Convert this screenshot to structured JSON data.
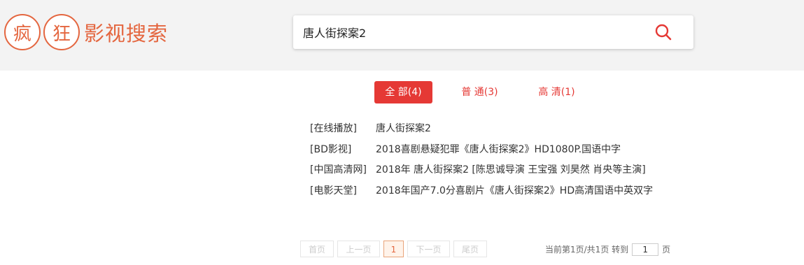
{
  "logo": {
    "char1": "疯",
    "char2": "狂",
    "text": "影视搜索"
  },
  "search": {
    "value": "唐人街探案2",
    "icon": "search-icon"
  },
  "tabs": [
    {
      "label": "全 部(4)",
      "active": true
    },
    {
      "label": "普 通(3)",
      "active": false
    },
    {
      "label": "高 清(1)",
      "active": false
    }
  ],
  "results": [
    {
      "source": "[在线播放]",
      "title": "唐人街探案2"
    },
    {
      "source": "[BD影视]",
      "title": "2018喜剧悬疑犯罪《唐人街探案2》HD1080P.国语中字"
    },
    {
      "source": "[中国高清网]",
      "title": "2018年 唐人街探案2 [陈思诚导演 王宝强 刘昊然 肖央等主演]"
    },
    {
      "source": "[电影天堂]",
      "title": "2018年国产7.0分喜剧片《唐人街探案2》HD高清国语中英双字"
    }
  ],
  "pagination": {
    "first": "首页",
    "prev": "上一页",
    "current": "1",
    "next": "下一页",
    "last": "尾页",
    "info": "当前第1页/共1页 转到",
    "goto_value": "1",
    "page_suffix": "页"
  },
  "colors": {
    "accent": "#e4663f",
    "tab_red": "#e53935"
  }
}
